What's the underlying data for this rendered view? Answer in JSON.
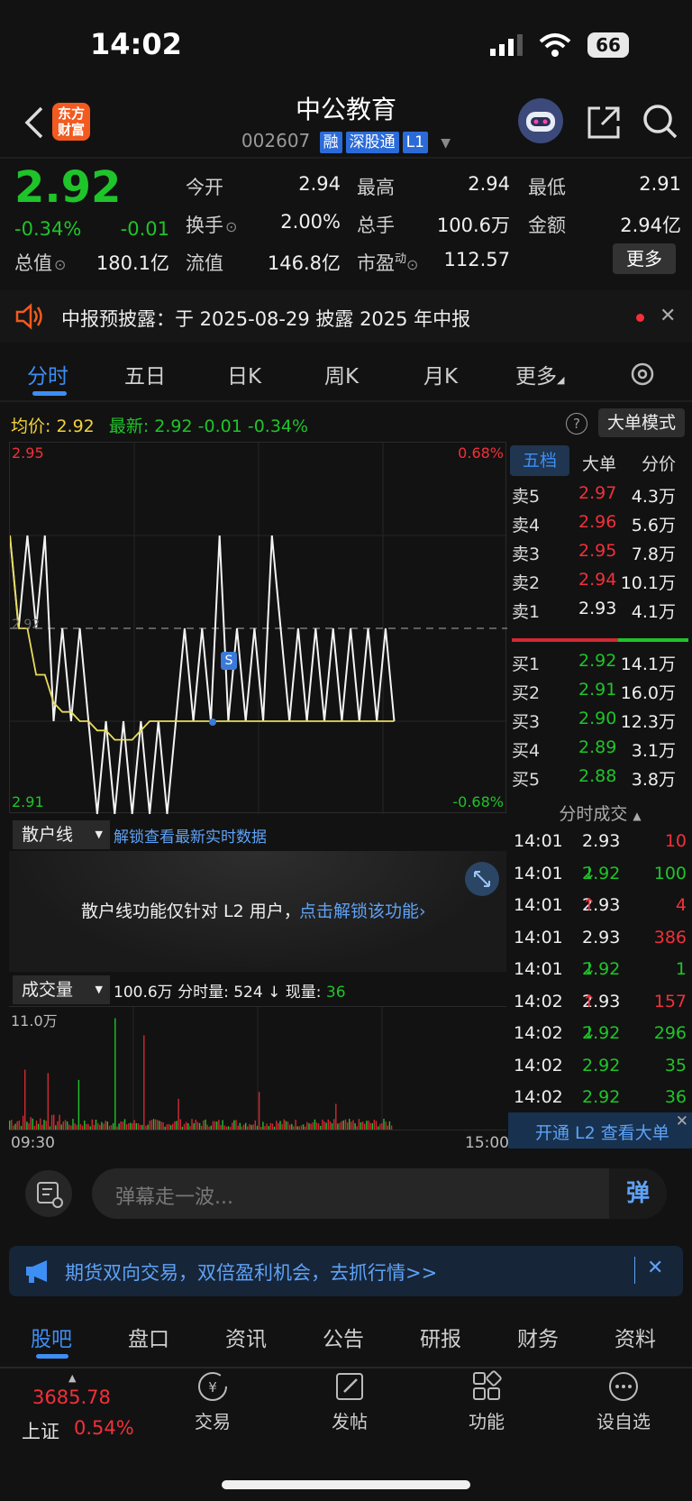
{
  "status": {
    "time": "14:02",
    "battery": "66"
  },
  "header": {
    "title": "中公教育",
    "code": "002607",
    "tags": [
      "融",
      "深股通",
      "L1"
    ],
    "logo_text": "东方财富"
  },
  "quote": {
    "price": "2.92",
    "change_pct": "-0.34%",
    "change": "-0.01",
    "fields": [
      {
        "label": "今开",
        "value": "2.94",
        "color": "red"
      },
      {
        "label": "最高",
        "value": "2.94",
        "color": "red"
      },
      {
        "label": "最低",
        "value": "2.91",
        "color": "green"
      },
      {
        "label": "换手",
        "value": "2.00%",
        "color": "white"
      },
      {
        "label": "总手",
        "value": "100.6万",
        "color": "white"
      },
      {
        "label": "金额",
        "value": "2.94亿",
        "color": "white"
      },
      {
        "label": "总值",
        "value": "180.1亿",
        "color": "white"
      },
      {
        "label": "流值",
        "value": "146.8亿",
        "color": "white"
      },
      {
        "label": "市盈",
        "label_sup": "动",
        "value": "112.57",
        "color": "white"
      }
    ],
    "more_label": "更多"
  },
  "notice": {
    "text": "中报预披露：于 2025-08-29 披露 2025 年中报"
  },
  "tabs": [
    "分时",
    "五日",
    "日K",
    "周K",
    "月K",
    "更多"
  ],
  "chart_header": {
    "avg_label": "均价:",
    "avg_value": "2.92",
    "latest_label": "最新:",
    "latest_value": "2.92",
    "latest_change": "-0.01",
    "latest_pct": "-0.34%",
    "mode_button": "大单模式"
  },
  "chart_data": {
    "type": "line",
    "title": "",
    "y_max_label": "2.95",
    "y_min_label": "2.91",
    "y_mid_label": "2.92",
    "pct_max_label": "0.68%",
    "pct_min_label": "-0.68%",
    "ylim": [
      2.91,
      2.95
    ],
    "x_start_label": "09:30",
    "x_end_label": "15:00",
    "series": [
      {
        "values": [
          2.94,
          2.93,
          2.94,
          2.93,
          2.94,
          2.92,
          2.93,
          2.92,
          2.93,
          2.92,
          2.91,
          2.92,
          2.91,
          2.92,
          2.91,
          2.92,
          2.91,
          2.92,
          2.91,
          2.92,
          2.93,
          2.92,
          2.93,
          2.92,
          2.94,
          2.92,
          2.93,
          2.92,
          2.93,
          2.92,
          2.94,
          2.93,
          2.92,
          2.93,
          2.92,
          2.93,
          2.92,
          2.93,
          2.92,
          2.93,
          2.92,
          2.93,
          2.92,
          2.93,
          2.92
        ]
      },
      {
        "values": [
          2.94,
          2.93,
          2.93,
          2.925,
          2.925,
          2.922,
          2.921,
          2.921,
          2.92,
          2.92,
          2.919,
          2.919,
          2.918,
          2.918,
          2.918,
          2.919,
          2.92,
          2.92,
          2.92,
          2.92,
          2.92,
          2.92,
          2.92,
          2.92,
          2.92,
          2.92,
          2.92,
          2.92,
          2.92,
          2.92,
          2.92,
          2.92,
          2.92,
          2.92,
          2.92,
          2.92,
          2.92,
          2.92,
          2.92,
          2.92,
          2.92,
          2.92,
          2.92,
          2.92,
          2.92
        ]
      }
    ]
  },
  "orderbook": {
    "tabs": [
      "五档",
      "大单",
      "分价"
    ],
    "asks": [
      {
        "label": "卖5",
        "price": "2.97",
        "vol": "4.3万"
      },
      {
        "label": "卖4",
        "price": "2.96",
        "vol": "5.6万"
      },
      {
        "label": "卖3",
        "price": "2.95",
        "vol": "7.8万"
      },
      {
        "label": "卖2",
        "price": "2.94",
        "vol": "10.1万"
      },
      {
        "label": "卖1",
        "price": "2.93",
        "vol": "4.1万"
      }
    ],
    "bids": [
      {
        "label": "买1",
        "price": "2.92",
        "vol": "14.1万"
      },
      {
        "label": "买2",
        "price": "2.91",
        "vol": "16.0万"
      },
      {
        "label": "买3",
        "price": "2.90",
        "vol": "12.3万"
      },
      {
        "label": "买4",
        "price": "2.89",
        "vol": "3.1万"
      },
      {
        "label": "买5",
        "price": "2.88",
        "vol": "3.8万"
      }
    ],
    "trades_title": "分时成交",
    "trades": [
      {
        "time": "14:01",
        "price": "2.93",
        "arrow": "",
        "vol": "10",
        "pc": "white",
        "vc": "red"
      },
      {
        "time": "14:01",
        "price": "2.92",
        "arrow": "↓",
        "vol": "100",
        "pc": "green",
        "vc": "green"
      },
      {
        "time": "14:01",
        "price": "2.93",
        "arrow": "↑",
        "vol": "4",
        "pc": "white",
        "vc": "red"
      },
      {
        "time": "14:01",
        "price": "2.93",
        "arrow": "",
        "vol": "386",
        "pc": "white",
        "vc": "red"
      },
      {
        "time": "14:01",
        "price": "2.92",
        "arrow": "↓",
        "vol": "1",
        "pc": "green",
        "vc": "green"
      },
      {
        "time": "14:02",
        "price": "2.93",
        "arrow": "↑",
        "vol": "157",
        "pc": "white",
        "vc": "red"
      },
      {
        "time": "14:02",
        "price": "2.92",
        "arrow": "↓",
        "vol": "296",
        "pc": "green",
        "vc": "green"
      },
      {
        "time": "14:02",
        "price": "2.92",
        "arrow": "",
        "vol": "35",
        "pc": "green",
        "vc": "green"
      },
      {
        "time": "14:02",
        "price": "2.92",
        "arrow": "",
        "vol": "36",
        "pc": "green",
        "vc": "green"
      }
    ],
    "l2_banner": "开通 L2 查看大单"
  },
  "retail": {
    "dropdown": "散户线",
    "unlock_link": "解锁查看最新实时数据",
    "message": "散户线功能仅针对 L2 用户，",
    "message_link": "点击解锁该功能"
  },
  "volume": {
    "dropdown": "成交量",
    "total": "100.6万",
    "interval_label": "分时量:",
    "interval_value": "524",
    "current_label": "现量:",
    "current_value": "36",
    "ymax_label": "11.0万"
  },
  "danmu": {
    "placeholder": "弹幕走一波...",
    "button": "弹"
  },
  "ad": {
    "text": "期货双向交易，双倍盈利机会，去抓行情>>"
  },
  "bottom_tabs": [
    "股吧",
    "盘口",
    "资讯",
    "公告",
    "研报",
    "财务",
    "资料"
  ],
  "bottom_nav": {
    "index_value": "3685.78",
    "index_name": "上证",
    "index_pct": "0.54%",
    "items": [
      "交易",
      "发帖",
      "功能",
      "设自选"
    ]
  }
}
